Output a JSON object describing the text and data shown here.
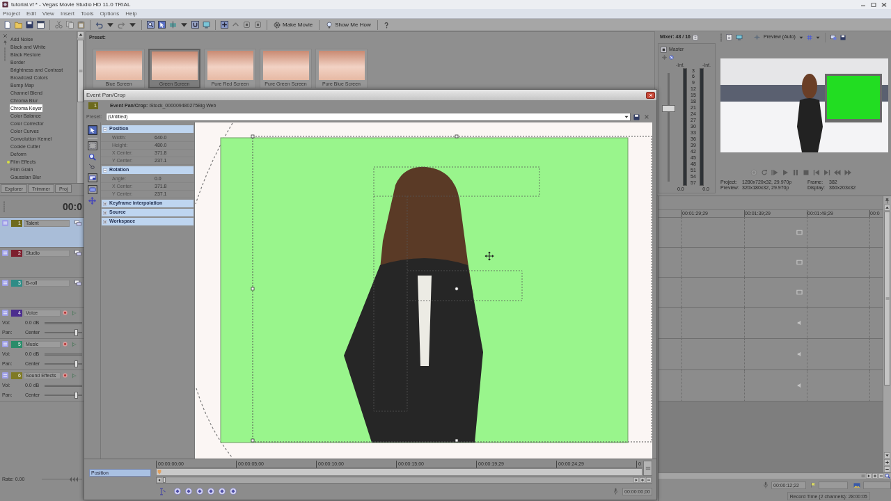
{
  "window": {
    "title": "tutorial.vf * - Vegas Movie Studio HD 11.0 TRIAL"
  },
  "menu": [
    {
      "label": "Project"
    },
    {
      "label": "Edit"
    },
    {
      "label": "View"
    },
    {
      "label": "Insert"
    },
    {
      "label": "Tools"
    },
    {
      "label": "Options"
    },
    {
      "label": "Help"
    }
  ],
  "toolbar": [
    {
      "label": "Make Movie"
    },
    {
      "label": "Show Me How"
    }
  ],
  "effects": {
    "items": [
      {
        "label": "Add Noise",
        "selected": false,
        "marked": false
      },
      {
        "label": "Black and White",
        "selected": false,
        "marked": false
      },
      {
        "label": "Black Restore",
        "selected": false,
        "marked": false
      },
      {
        "label": "Border",
        "selected": false,
        "marked": false
      },
      {
        "label": "Brightness and Contrast",
        "selected": false,
        "marked": false
      },
      {
        "label": "Broadcast Colors",
        "selected": false,
        "marked": false
      },
      {
        "label": "Bump Map",
        "selected": false,
        "marked": false
      },
      {
        "label": "Channel Blend",
        "selected": false,
        "marked": false
      },
      {
        "label": "Chroma Blur",
        "selected": false,
        "marked": false
      },
      {
        "label": "Chroma Keyer",
        "selected": true,
        "marked": false
      },
      {
        "label": "Color Balance",
        "selected": false,
        "marked": false
      },
      {
        "label": "Color Corrector",
        "selected": false,
        "marked": false
      },
      {
        "label": "Color Curves",
        "selected": false,
        "marked": false
      },
      {
        "label": "Convolution Kernel",
        "selected": false,
        "marked": false
      },
      {
        "label": "Cookie Cutter",
        "selected": false,
        "marked": false
      },
      {
        "label": "Deform",
        "selected": false,
        "marked": false
      },
      {
        "label": "Film Effects",
        "selected": false,
        "marked": true
      },
      {
        "label": "Film Grain",
        "selected": false,
        "marked": false
      },
      {
        "label": "Gaussian Blur",
        "selected": false,
        "marked": false
      }
    ],
    "tabs": [
      {
        "label": "Explorer",
        "selected": false
      },
      {
        "label": "Trimmer",
        "selected": false
      },
      {
        "label": "Proj",
        "selected": false
      }
    ]
  },
  "presets": {
    "title": "Preset:",
    "items": [
      {
        "label": "Blue Screen",
        "selected": false
      },
      {
        "label": "Green Screen",
        "selected": true
      },
      {
        "label": "Pure Red Screen",
        "selected": false
      },
      {
        "label": "Pure Green Screen",
        "selected": false
      },
      {
        "label": "Pure Blue Screen",
        "selected": false
      }
    ]
  },
  "mixer": {
    "title": "Mixer: 48 / 16",
    "channel": "Master",
    "fader": {
      "level": 0.67
    },
    "meters": [
      {
        "peak": "-Inf.",
        "reading": "0.0"
      },
      {
        "peak": "-Inf.",
        "reading": "0.0"
      }
    ],
    "scale": [
      "3",
      "6",
      "9",
      "12",
      "15",
      "18",
      "21",
      "24",
      "27",
      "30",
      "33",
      "36",
      "39",
      "42",
      "45",
      "48",
      "51",
      "54",
      "57"
    ]
  },
  "preview": {
    "mode": "Preview (Auto)",
    "info": [
      {
        "label": "Project:",
        "value": "1280x720x32, 29.970p"
      },
      {
        "label": "Frame:",
        "value": "382"
      },
      {
        "label": "Preview:",
        "value": "320x180x32, 29.970p"
      },
      {
        "label": "Display:",
        "value": "360x203x32"
      }
    ]
  },
  "tracks": {
    "time": "00:0",
    "items": [
      {
        "number": "1",
        "name": "Talent",
        "kind": "video",
        "color": "#6f6a1d",
        "selected": true
      },
      {
        "number": "2",
        "name": "Studio",
        "kind": "video",
        "color": "#7d1f2e",
        "selected": false
      },
      {
        "number": "3",
        "name": "B-roll",
        "kind": "video",
        "color": "#2f8c86",
        "selected": false
      },
      {
        "number": "4",
        "name": "Voice",
        "kind": "audio",
        "color": "#4b2d8e",
        "selected": false,
        "vol_label": "Vol:",
        "vol": "0.0 dB",
        "pan_label": "Pan:",
        "pan": "Center",
        "pan_slider": {
          "level": 0.85
        }
      },
      {
        "number": "5",
        "name": "Music",
        "kind": "audio",
        "color": "#2a8c6a",
        "selected": false,
        "vol_label": "Vol:",
        "vol": "0.0 dB",
        "pan_label": "Pan:",
        "pan": "Center",
        "pan_slider": {
          "level": 0.85
        }
      },
      {
        "number": "6",
        "name": "Sound Effects",
        "kind": "audio",
        "color": "#7f7a24",
        "selected": false,
        "vol_label": "Vol:",
        "vol": "0.0 dB",
        "pan_label": "Pan:",
        "pan": "Center",
        "pan_slider": {
          "level": 0.85
        }
      }
    ],
    "rate": {
      "label": "Rate: 0.00",
      "level": 0.8
    }
  },
  "timeline": {
    "ruler": [
      "00:01:29;29",
      "00:01:39;29",
      "00:01:49;29",
      "00:0"
    ],
    "cursor_time": "00:00:12;22",
    "record_time": "Record Time (2 channels): 28:00:05"
  },
  "dialog": {
    "title": "Event Pan/Crop",
    "track_number": "1",
    "header": "**Event Pan/Crop:** iStock_000009480275Big Web",
    "preset_label": "Preset:",
    "preset": "(Untitled)",
    "groups": [
      {
        "label": "Position",
        "expanded": true,
        "rows": [
          {
            "label": "Width:",
            "value": "640.0"
          },
          {
            "label": "Height:",
            "value": "480.0"
          },
          {
            "label": "X Center:",
            "value": "371.8"
          },
          {
            "label": "Y Center:",
            "value": "237.1"
          }
        ]
      },
      {
        "label": "Rotation",
        "expanded": true,
        "rows": [
          {
            "label": "Angle:",
            "value": "0.0"
          },
          {
            "label": "X Center:",
            "value": "371.8"
          },
          {
            "label": "Y Center:",
            "value": "237.1"
          }
        ]
      },
      {
        "label": "Keyframe interpolation",
        "expanded": false
      },
      {
        "label": "Source",
        "expanded": false
      },
      {
        "label": "Workspace",
        "expanded": false
      }
    ],
    "keyframes": {
      "tracks": [
        {
          "label": "Position",
          "selected": true
        }
      ],
      "ruler": [
        "00:00:00;00",
        "00:00:05;00",
        "00:00:10;00",
        "00:00:15;00",
        "00:00:19;29",
        "00:00:24;29",
        "0"
      ],
      "time": "00:00:00;00"
    }
  }
}
